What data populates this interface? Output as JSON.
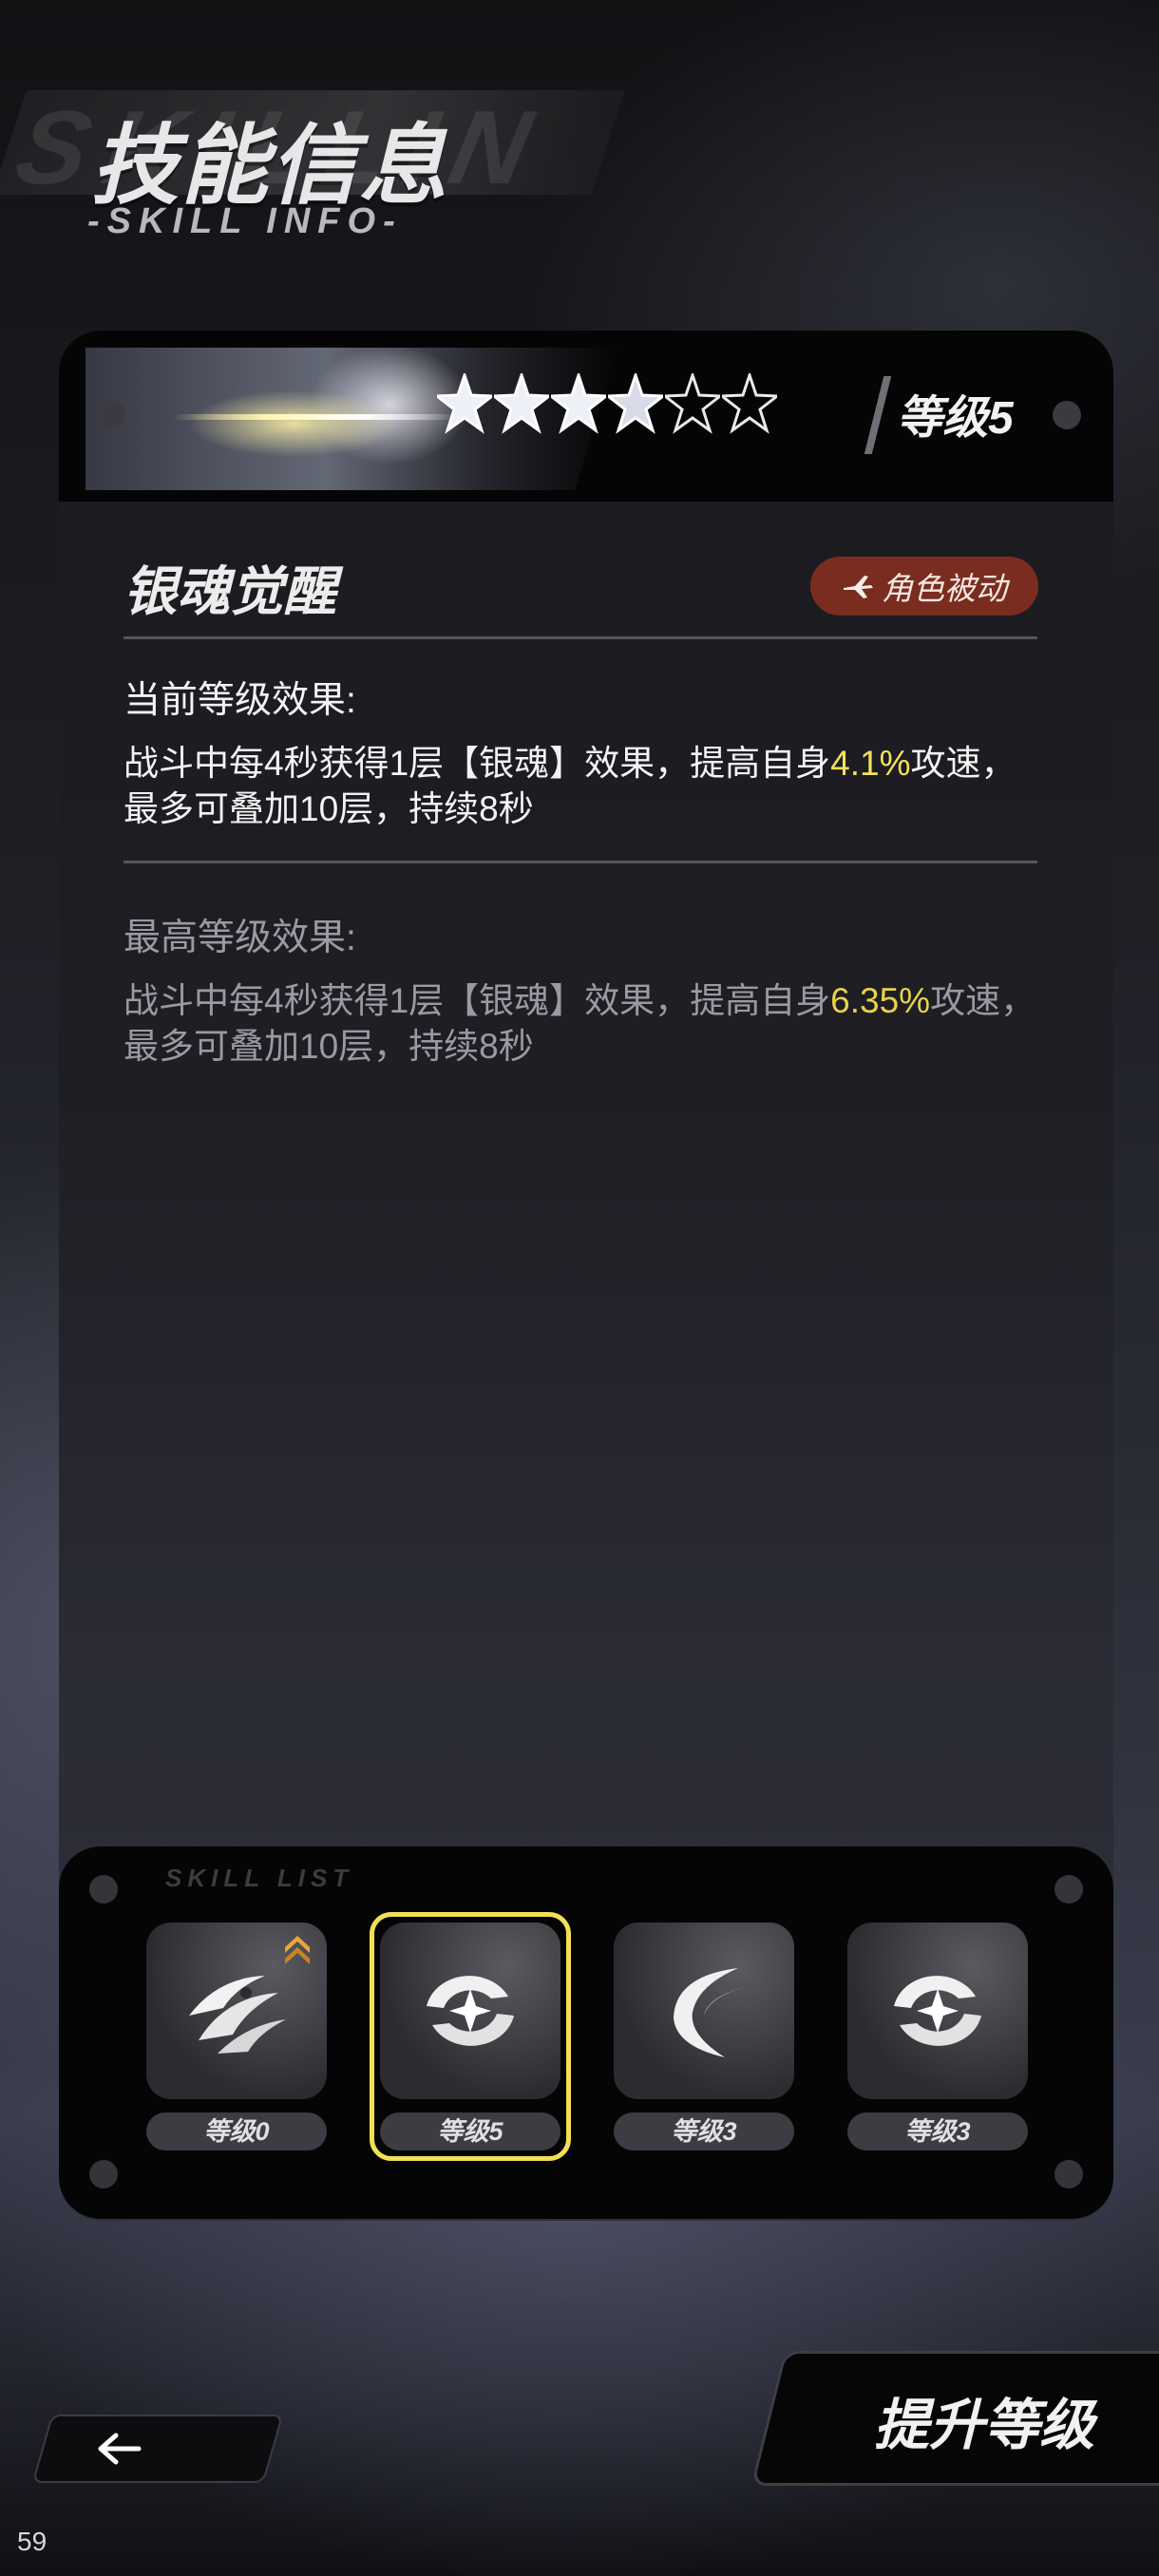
{
  "header": {
    "title": "技能信息",
    "subtitle": "-SKILL INFO-"
  },
  "skill_card": {
    "level_label": "等级5",
    "stars_filled": 4,
    "stars_total": 6,
    "name": "银魂觉醒",
    "type_badge": "角色被动",
    "current": {
      "title": "当前等级效果:",
      "text_before": "战斗中每4秒获得1层【银魂】效果，提高自身",
      "highlight": "4.1%",
      "text_after": "攻速，最多可叠加10层，持续8秒"
    },
    "max": {
      "title": "最高等级效果:",
      "text_before": "战斗中每4秒获得1层【银魂】效果，提高自身",
      "highlight": "6.35%",
      "text_after": "攻速，最多可叠加10层，持续8秒"
    },
    "colors": {
      "highlight": "#f4e05a",
      "badge": "#7a2d1e",
      "selected_outline": "#f3df55"
    }
  },
  "skill_list": {
    "tag": "SKILL LIST",
    "slots": [
      {
        "icon": "claw-slash-icon",
        "level_label": "等级0",
        "upgradable": true,
        "selected": false
      },
      {
        "icon": "crosshair-star-icon",
        "level_label": "等级5",
        "upgradable": false,
        "selected": true
      },
      {
        "icon": "crescent-blade-icon",
        "level_label": "等级3",
        "upgradable": false,
        "selected": false
      },
      {
        "icon": "crosshair-star-icon",
        "level_label": "等级3",
        "upgradable": false,
        "selected": false
      }
    ]
  },
  "actions": {
    "upgrade_label": "提升等级",
    "back_icon": "arrow-left-icon"
  },
  "fps": "59"
}
